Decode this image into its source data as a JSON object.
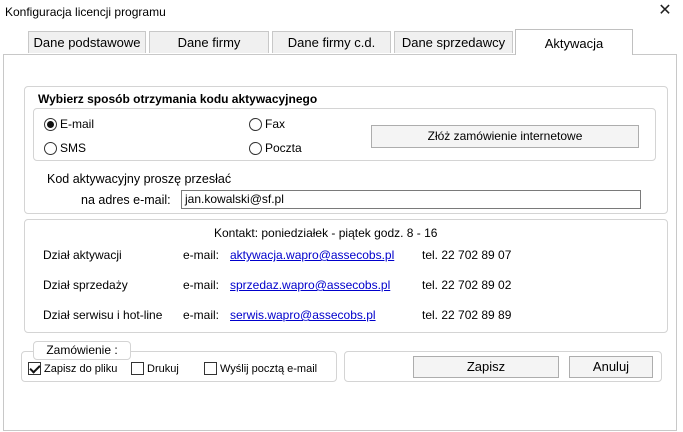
{
  "window": {
    "title": "Konfiguracja licencji programu",
    "close_glyph": "✕"
  },
  "tabs": [
    {
      "label": "Dane podstawowe"
    },
    {
      "label": "Dane firmy"
    },
    {
      "label": "Dane firmy c.d."
    },
    {
      "label": "Dane sprzedawcy"
    },
    {
      "label": "Aktywacja",
      "active": true
    }
  ],
  "activation_method": {
    "title": "Wybierz sposób otrzymania kodu aktywacyjnego",
    "options": [
      {
        "label": "E-mail",
        "checked": true
      },
      {
        "label": "Fax",
        "checked": false
      },
      {
        "label": "SMS",
        "checked": false
      },
      {
        "label": "Poczta",
        "checked": false
      }
    ],
    "order_button": "Złóż zamówienie internetowe",
    "send_label_line1": "Kod aktywacyjny proszę przesłać",
    "send_label_line2": "na adres e-mail:",
    "email_value": "jan.kowalski@sf.pl"
  },
  "contacts": {
    "header": "Kontakt: poniedziałek - piątek  godz. 8 - 16",
    "rows": [
      {
        "dept": "Dział aktywacji",
        "email_label": "e-mail:",
        "email": "aktywacja.wapro@assecobs.pl",
        "phone": "tel. 22 702 89 07"
      },
      {
        "dept": "Dział sprzedaży",
        "email_label": "e-mail:",
        "email": "sprzedaz.wapro@assecobs.pl",
        "phone": "tel. 22 702 89 02"
      },
      {
        "dept": "Dział serwisu i hot-line",
        "email_label": "e-mail:",
        "email": "serwis.wapro@assecobs.pl",
        "phone": "tel. 22 702 89 89"
      }
    ]
  },
  "order": {
    "title": "Zamówienie :",
    "options": [
      {
        "label": "Zapisz do pliku",
        "checked": true
      },
      {
        "label": "Drukuj",
        "checked": false
      },
      {
        "label": "Wyślij pocztą e-mail",
        "checked": false
      }
    ]
  },
  "buttons": {
    "save": "Zapisz",
    "cancel": "Anuluj"
  },
  "colors": {
    "link": "#0000cc",
    "border": "#d4d4d4"
  }
}
